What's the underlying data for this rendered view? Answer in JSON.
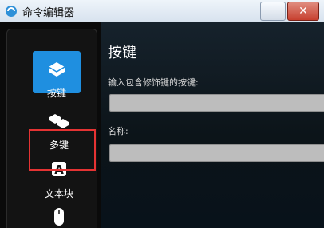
{
  "window": {
    "title": "命令编辑器",
    "close_label": "✕"
  },
  "sidebar": {
    "items": [
      {
        "label": "按键",
        "active": true,
        "icon": "keycap-icon"
      },
      {
        "label": "多键",
        "active": false,
        "icon": "multi-keys-icon"
      },
      {
        "label": "文本块",
        "active": false,
        "icon": "text-block-icon"
      },
      {
        "label": "",
        "active": false,
        "icon": "mouse-icon"
      }
    ]
  },
  "main": {
    "heading": "按键",
    "field_keys_label": "输入包含修饰键的按键:",
    "field_keys_value": "",
    "field_name_label": "名称:",
    "field_name_value": ""
  },
  "colors": {
    "accent": "#1f8fe0",
    "highlight": "#e53333"
  }
}
